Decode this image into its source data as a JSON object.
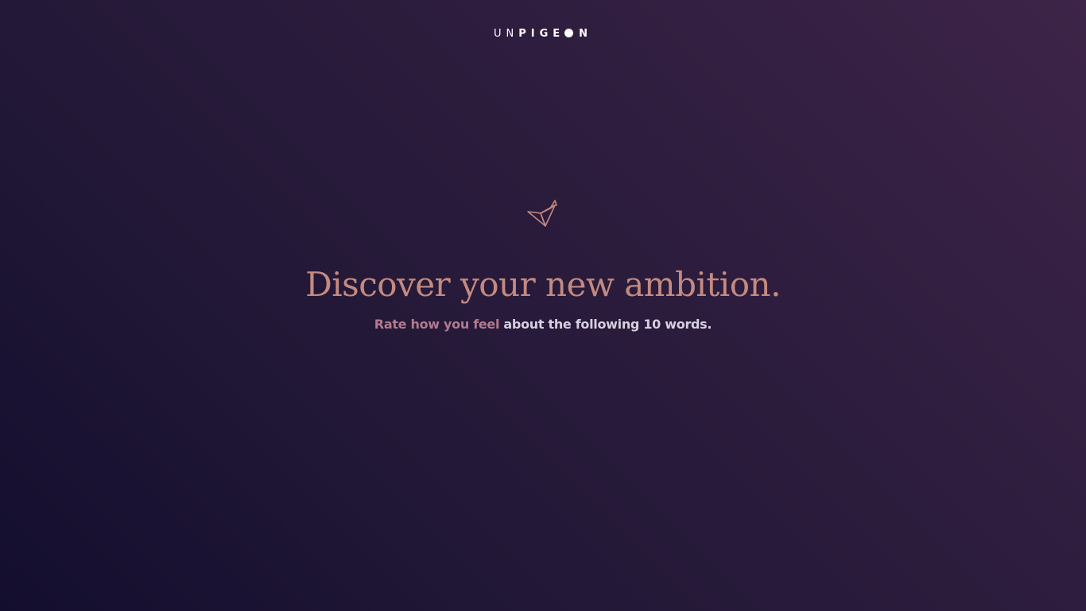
{
  "logo": {
    "prefix": "UN",
    "middle": "PIGE",
    "suffix": "N"
  },
  "hero": {
    "icon": "origami-bird-icon",
    "headline": "Discover your new ambition.",
    "sub_accent": "Rate how you feel",
    "sub_rest": " about the following 10 words."
  },
  "colors": {
    "accent": "#c48a80",
    "accent_pink": "#b27a8e",
    "text_light": "#d6cfe0",
    "bg_dark": "#140e2e",
    "bg_light": "#3d2448"
  }
}
